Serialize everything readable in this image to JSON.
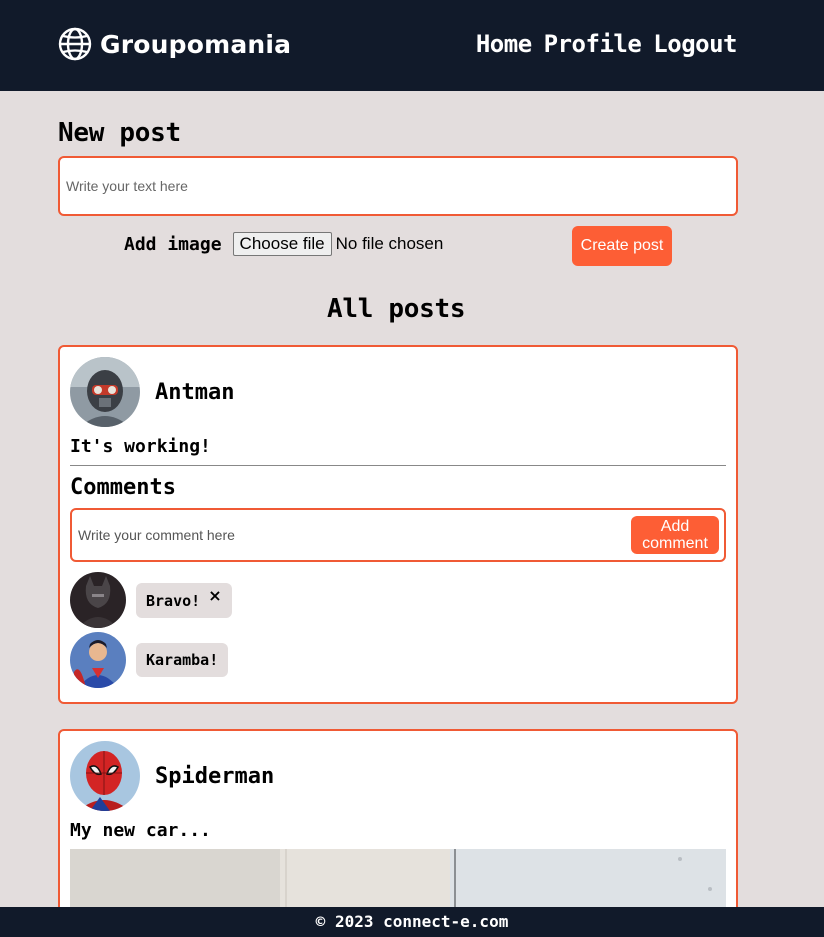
{
  "header": {
    "brand": "Groupomania",
    "nav": [
      "Home",
      "Profile",
      "Logout"
    ]
  },
  "new_post": {
    "title": "New post",
    "placeholder": "Write your text here",
    "add_image_label": "Add image",
    "file_button": "Choose file",
    "file_status": "No file chosen",
    "create_button": "Create post"
  },
  "all_posts": {
    "title": "All posts"
  },
  "posts": [
    {
      "author": "Antman",
      "text": "It's working!",
      "comments_title": "Comments",
      "comment_placeholder": "Write your comment here",
      "add_comment_button": "Add comment",
      "comments": [
        {
          "text": "Bravo!",
          "deletable": true,
          "delete_icon": "×"
        },
        {
          "text": "Karamba!",
          "deletable": false
        }
      ]
    },
    {
      "author": "Spiderman",
      "text": "My new car..."
    }
  ],
  "footer": {
    "text": "© 2023 connect-e.com"
  },
  "colors": {
    "header_bg": "#111a2a",
    "page_bg": "#e3dddd",
    "accent": "#fd5e35"
  }
}
